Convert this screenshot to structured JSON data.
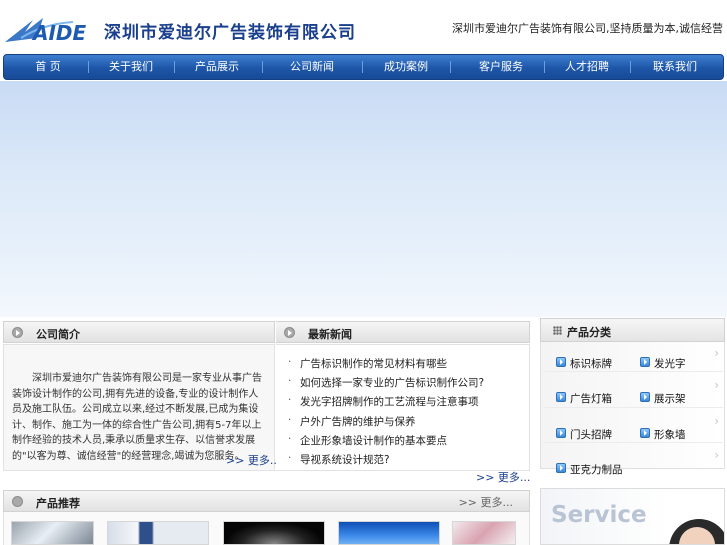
{
  "header": {
    "logo_text": "AIDE",
    "company_name": "深圳市爱迪尔广告装饰有限公司",
    "slogan": "深圳市爱迪尔广告装饰有限公司,坚持质量为本,诚信经营"
  },
  "nav": {
    "items": [
      {
        "label": "首 页"
      },
      {
        "label": "关于我们"
      },
      {
        "label": "产品展示"
      },
      {
        "label": "公司新闻"
      },
      {
        "label": "成功案例"
      },
      {
        "label": "客户服务"
      },
      {
        "label": "人才招聘"
      },
      {
        "label": "联系我们"
      }
    ]
  },
  "about": {
    "title": "公司简介",
    "text": "深圳市爱迪尔广告装饰有限公司是一家专业从事广告装饰设计制作的公司,拥有先进的设备,专业的设计制作人员及施工队伍。公司成立以来,经过不断发展,已成为集设计、制作、施工为一体的综合性广告公司,拥有5-7年以上制作经验的技术人员,秉承以质量求生存、以信誉求发展的\"以客为尊、诚信经营\"的经营理念,竭诚为您服务。",
    "more": ">> 更多..."
  },
  "news": {
    "title": "最新新闻",
    "items": [
      {
        "label": "广告标识制作的常见材料有哪些"
      },
      {
        "label": "如何选择一家专业的广告标识制作公司?"
      },
      {
        "label": "发光字招牌制作的工艺流程与注意事项"
      },
      {
        "label": "户外广告牌的维护与保养"
      },
      {
        "label": "企业形象墙设计制作的基本要点"
      },
      {
        "label": "导视系统设计规范?"
      }
    ],
    "more": ">> 更多..."
  },
  "categories": {
    "title": "产品分类",
    "items": [
      {
        "label": "标识标牌"
      },
      {
        "label": "发光字"
      },
      {
        "label": "广告灯箱"
      },
      {
        "label": "展示架"
      },
      {
        "label": "门头招牌"
      },
      {
        "label": "形象墙"
      },
      {
        "label": "亚克力制品"
      }
    ]
  },
  "products": {
    "title": "产品推荐",
    "more": ">> 更多..."
  },
  "service": {
    "label": "Service"
  }
}
